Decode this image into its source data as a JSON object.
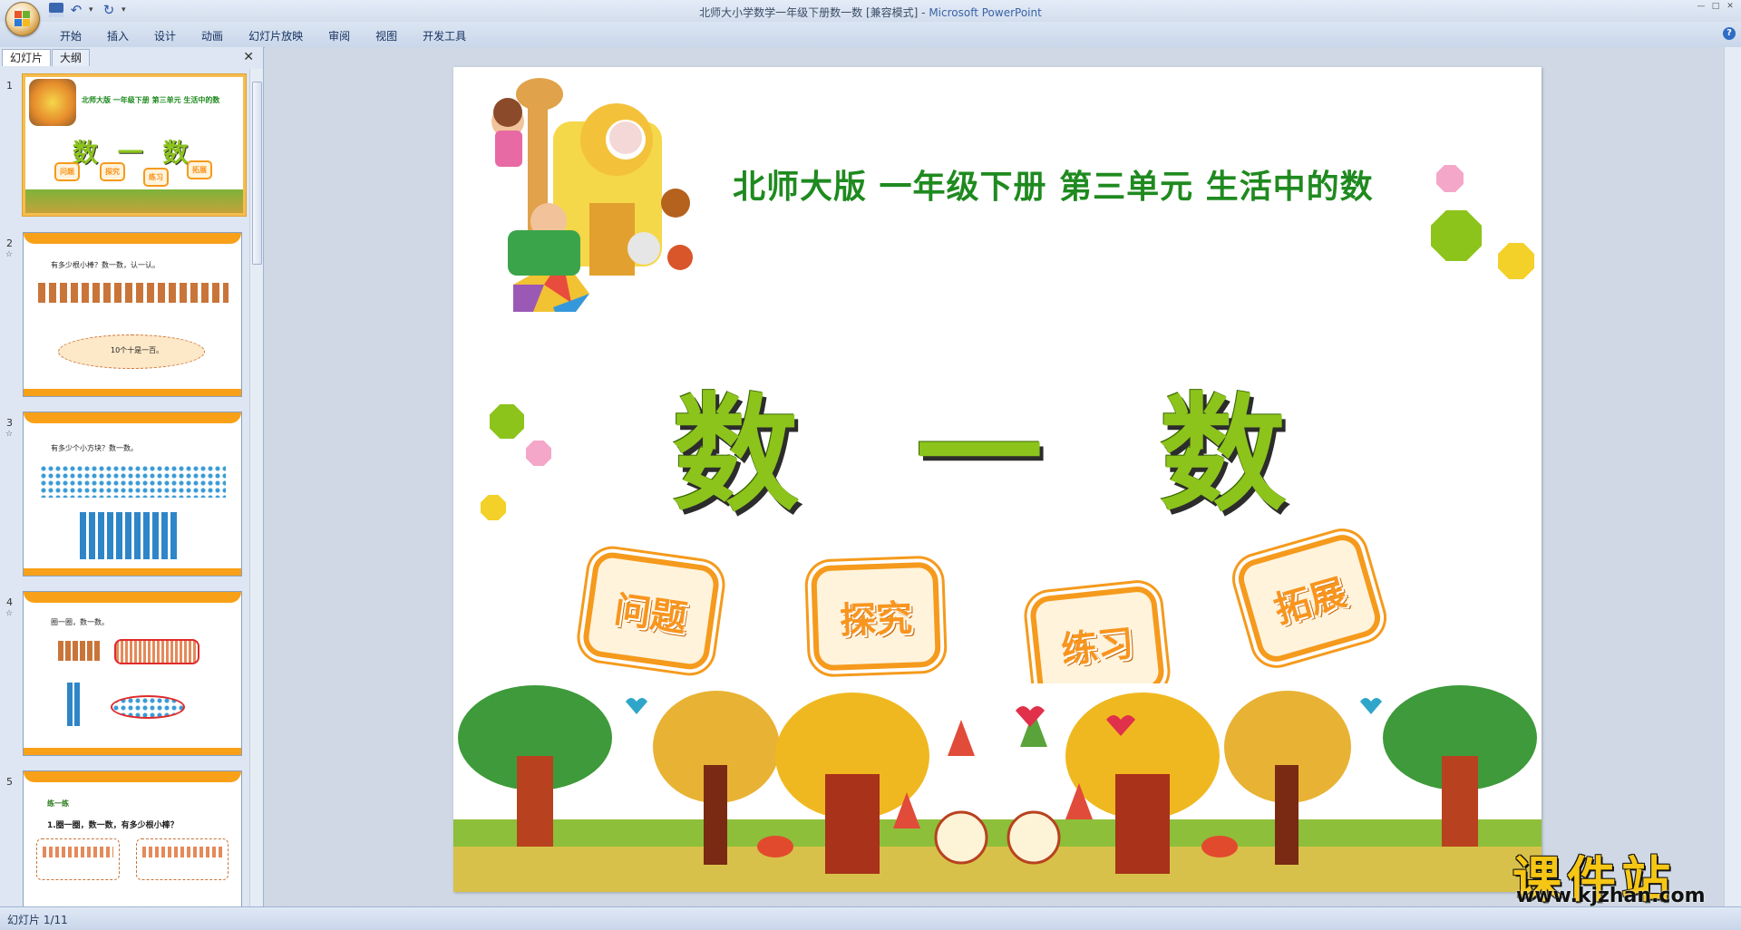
{
  "window": {
    "title": "北师大小学数学一年级下册数一数 [兼容模式]",
    "app_name": "Microsoft PowerPoint",
    "title_separator": " - "
  },
  "ribbon": {
    "tabs": [
      "开始",
      "插入",
      "设计",
      "动画",
      "幻灯片放映",
      "审阅",
      "视图",
      "开发工具"
    ]
  },
  "panel": {
    "tab_slides": "幻灯片",
    "tab_outline": "大纲"
  },
  "thumbnails": [
    {
      "num": "1",
      "subtitle": "北师大版  一年级下册  第三单元  生活中的数",
      "big": "数 一 数",
      "buttons": [
        "问题",
        "探究",
        "练习",
        "拓展"
      ]
    },
    {
      "num": "2",
      "text": "有多少根小棒？数一数，认一认。",
      "caption": "10个十是一百。"
    },
    {
      "num": "3",
      "text": "有多少个小方块？数一数。"
    },
    {
      "num": "4",
      "text": "圈一圈，数一数。"
    },
    {
      "num": "5",
      "heading": "练一练",
      "text": "1.圈一圈，数一数，有多少根小棒？"
    }
  ],
  "slide": {
    "subtitle": "北师大版  一年级下册  第三单元  生活中的数",
    "title": "数 一 数",
    "buttons": [
      "问题",
      "探究",
      "练习",
      "拓展"
    ],
    "watermark": "课件站",
    "watermark_url": "www.kjzhan.com"
  },
  "status": {
    "slide_counter": "幻灯片 1/11"
  },
  "colors": {
    "green_text": "#1f8a1f",
    "title_green": "#8cc41b",
    "orange": "#f59a1c",
    "chrome": "#dde6f2"
  }
}
